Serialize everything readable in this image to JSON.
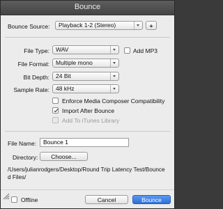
{
  "window": {
    "title": "Bounce"
  },
  "bounce_source": {
    "label": "Bounce Source:",
    "value": "Playback 1-2 (Stereo)",
    "add_button": "+"
  },
  "file_type": {
    "label": "File Type:",
    "value": "WAV"
  },
  "add_mp3": {
    "label": "Add MP3",
    "checked": false
  },
  "file_format": {
    "label": "File Format:",
    "value": "Multiple mono"
  },
  "bit_depth": {
    "label": "Bit Depth:",
    "value": "24 Bit"
  },
  "sample_rate": {
    "label": "Sample Rate:",
    "value": "48 kHz"
  },
  "options": {
    "enforce": {
      "label": "Enforce Media Composer Compatibility",
      "checked": false
    },
    "import_after": {
      "label": "Import After Bounce",
      "checked": true
    },
    "itunes": {
      "label": "Add To iTunes Library",
      "checked": false,
      "disabled": true
    }
  },
  "file_name": {
    "label": "File Name:",
    "value": "Bounce 1"
  },
  "directory": {
    "label": "Directory:",
    "choose_button": "Choose..."
  },
  "path": {
    "line1": "/Users/julianrodgers/Desktop/Round Trip Latency Test/Bounce",
    "line2": "d Files/"
  },
  "footer": {
    "offline_label": "Offline",
    "offline_checked": false,
    "cancel_button": "Cancel",
    "bounce_button": "Bounce",
    "accent_color": "#2f6fd8"
  }
}
